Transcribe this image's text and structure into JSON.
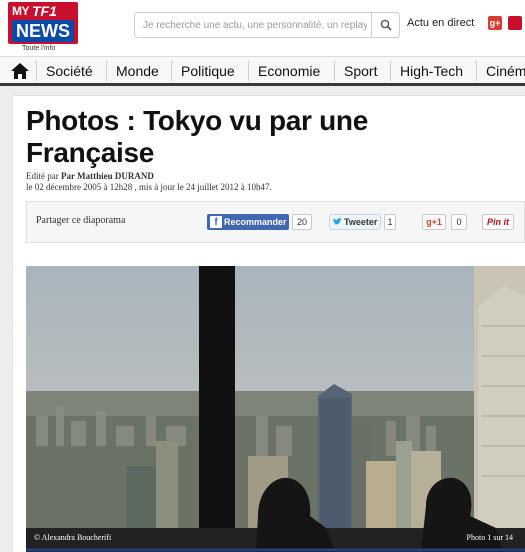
{
  "header": {
    "logo": {
      "my": "MY",
      "tf1": "TF1",
      "news": "NEWS",
      "tagline": "Toute l'info"
    },
    "search": {
      "placeholder": "Je recherche une actu, une personnalité, un replay ..."
    },
    "live_link": "Actu en direct",
    "social": {
      "gplus": "g+"
    }
  },
  "nav": {
    "items": [
      "Société",
      "Monde",
      "Politique",
      "Economie",
      "Sport",
      "High-Tech",
      "Ciném"
    ]
  },
  "article": {
    "title": "Photos : Tokyo vu par une Française",
    "edited_prefix": "Edité par",
    "author": "Par Matthieu DURAND",
    "dates": "le 02 décembre 2005 à 12h28 , mis à jour le 24 juillet 2012 à 10h47."
  },
  "share": {
    "label": "Partager ce diaporama",
    "facebook": {
      "label": "Recommander",
      "count": "20"
    },
    "twitter": {
      "label": "Tweeter",
      "count": "1"
    },
    "gplus": {
      "label": "+1",
      "count": "0"
    },
    "pinterest": {
      "label": "Pin it"
    }
  },
  "slideshow": {
    "credit": "© Alexandra Boucherifi",
    "counter": "Photo 1 sur 14"
  },
  "colors": {
    "brand_red": "#c8102e",
    "brand_blue": "#0a4aa8",
    "facebook": "#4267b2"
  }
}
